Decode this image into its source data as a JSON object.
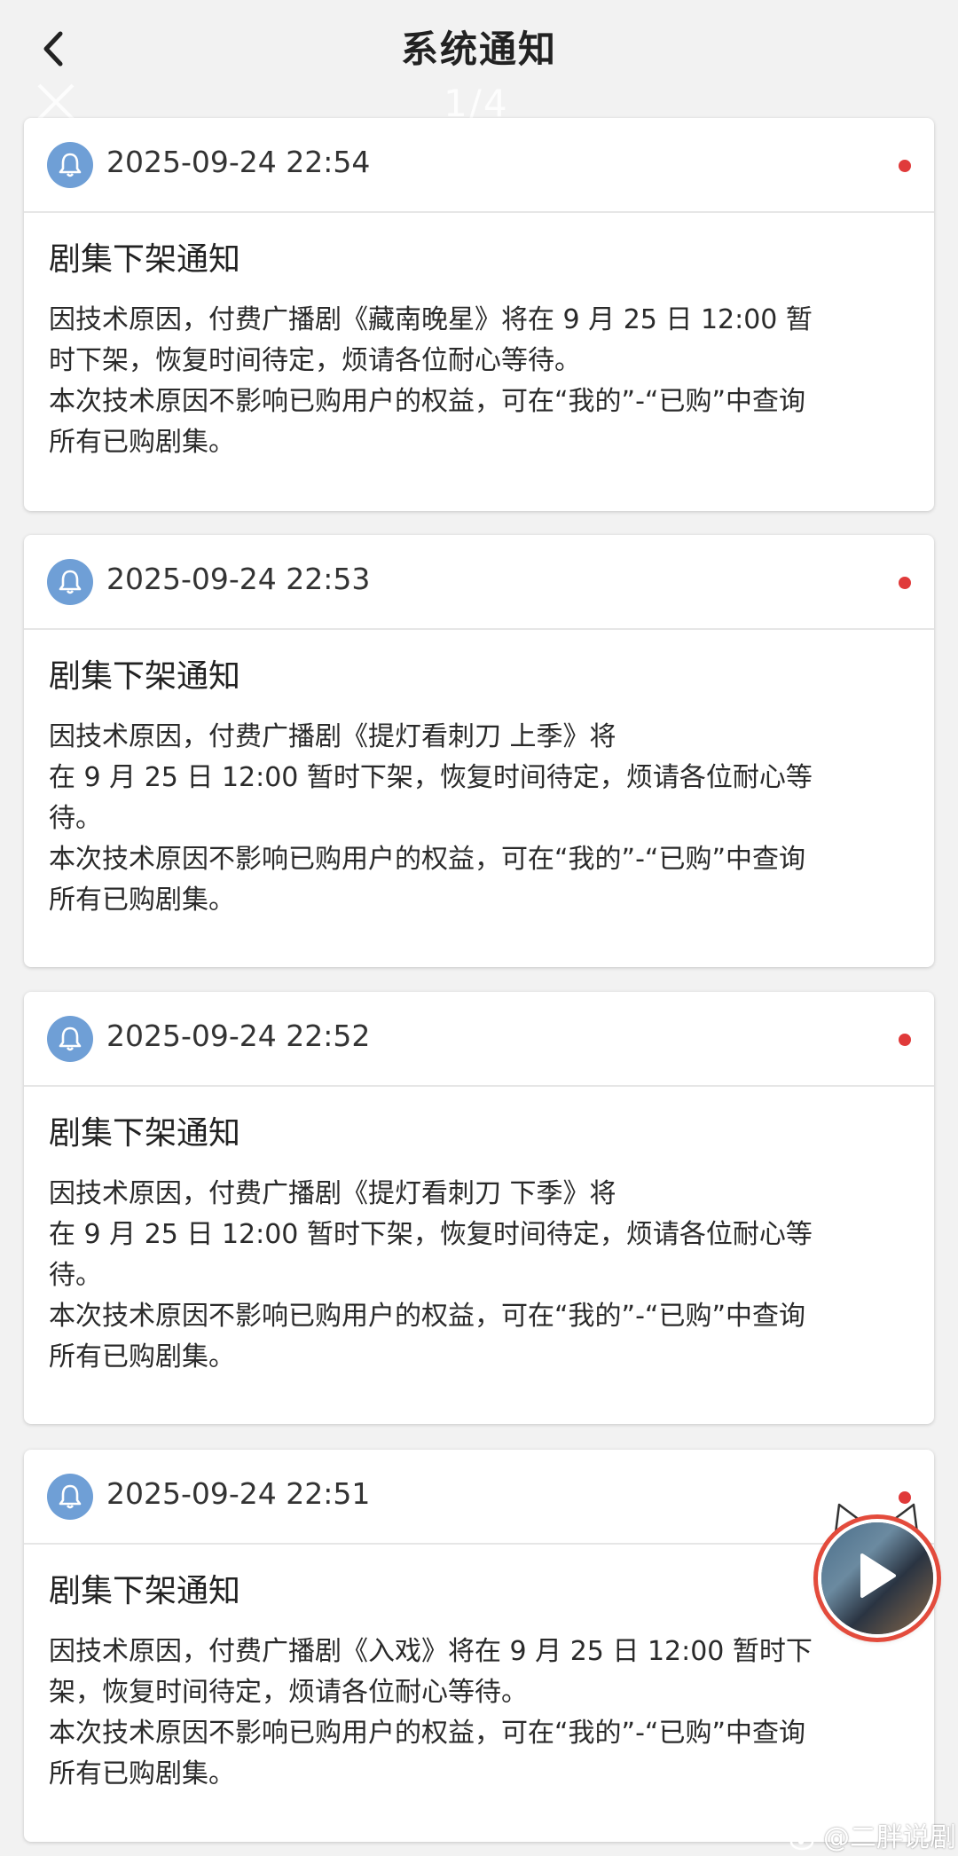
{
  "header": {
    "title": "系统通知",
    "back_icon": "chevron-left-icon"
  },
  "overlay": {
    "counter": "1/4",
    "close_icon": "close-icon"
  },
  "notifications": [
    {
      "time": "2025-09-24 22:54",
      "title": "剧集下架通知",
      "line1": "因技术原因，付费广播剧《藏南晚星》将在 9 月 25 日 12:00 暂\n时下架，恢复时间待定，烦请各位耐心等待。",
      "line2": "本次技术原因不影响已购用户的权益，可在“我的”-“已购”中查询\n所有已购剧集。",
      "unread": true
    },
    {
      "time": "2025-09-24 22:53",
      "title": "剧集下架通知",
      "line1": "因技术原因，付费广播剧《提灯看刺刀 上季》将\n在 9 月 25 日 12:00 暂时下架，恢复时间待定，烦请各位耐心等\n待。",
      "line2": "本次技术原因不影响已购用户的权益，可在“我的”-“已购”中查询\n所有已购剧集。",
      "unread": true
    },
    {
      "time": "2025-09-24 22:52",
      "title": "剧集下架通知",
      "line1": "因技术原因，付费广播剧《提灯看刺刀 下季》将\n在 9 月 25 日 12:00 暂时下架，恢复时间待定，烦请各位耐心等\n待。",
      "line2": "本次技术原因不影响已购用户的权益，可在“我的”-“已购”中查询\n所有已购剧集。",
      "unread": true
    },
    {
      "time": "2025-09-24 22:51",
      "title": "剧集下架通知",
      "line1": "因技术原因，付费广播剧《入戏》将在 9 月 25 日 12:00 暂时下\n架，恢复时间待定，烦请各位耐心等待。",
      "line2": "本次技术原因不影响已购用户的权益，可在“我的”-“已购”中查询\n所有已购剧集。",
      "unread": true
    }
  ],
  "floating_player": {
    "icon": "play-icon",
    "decoration": "cat-ears-icon"
  },
  "watermark": {
    "text": "@二胖说剧",
    "icon": "weibo-icon"
  },
  "colors": {
    "bell_bg": "#6f9fd6",
    "unread_dot": "#e03a3a",
    "page_bg": "#f2f2f2"
  }
}
